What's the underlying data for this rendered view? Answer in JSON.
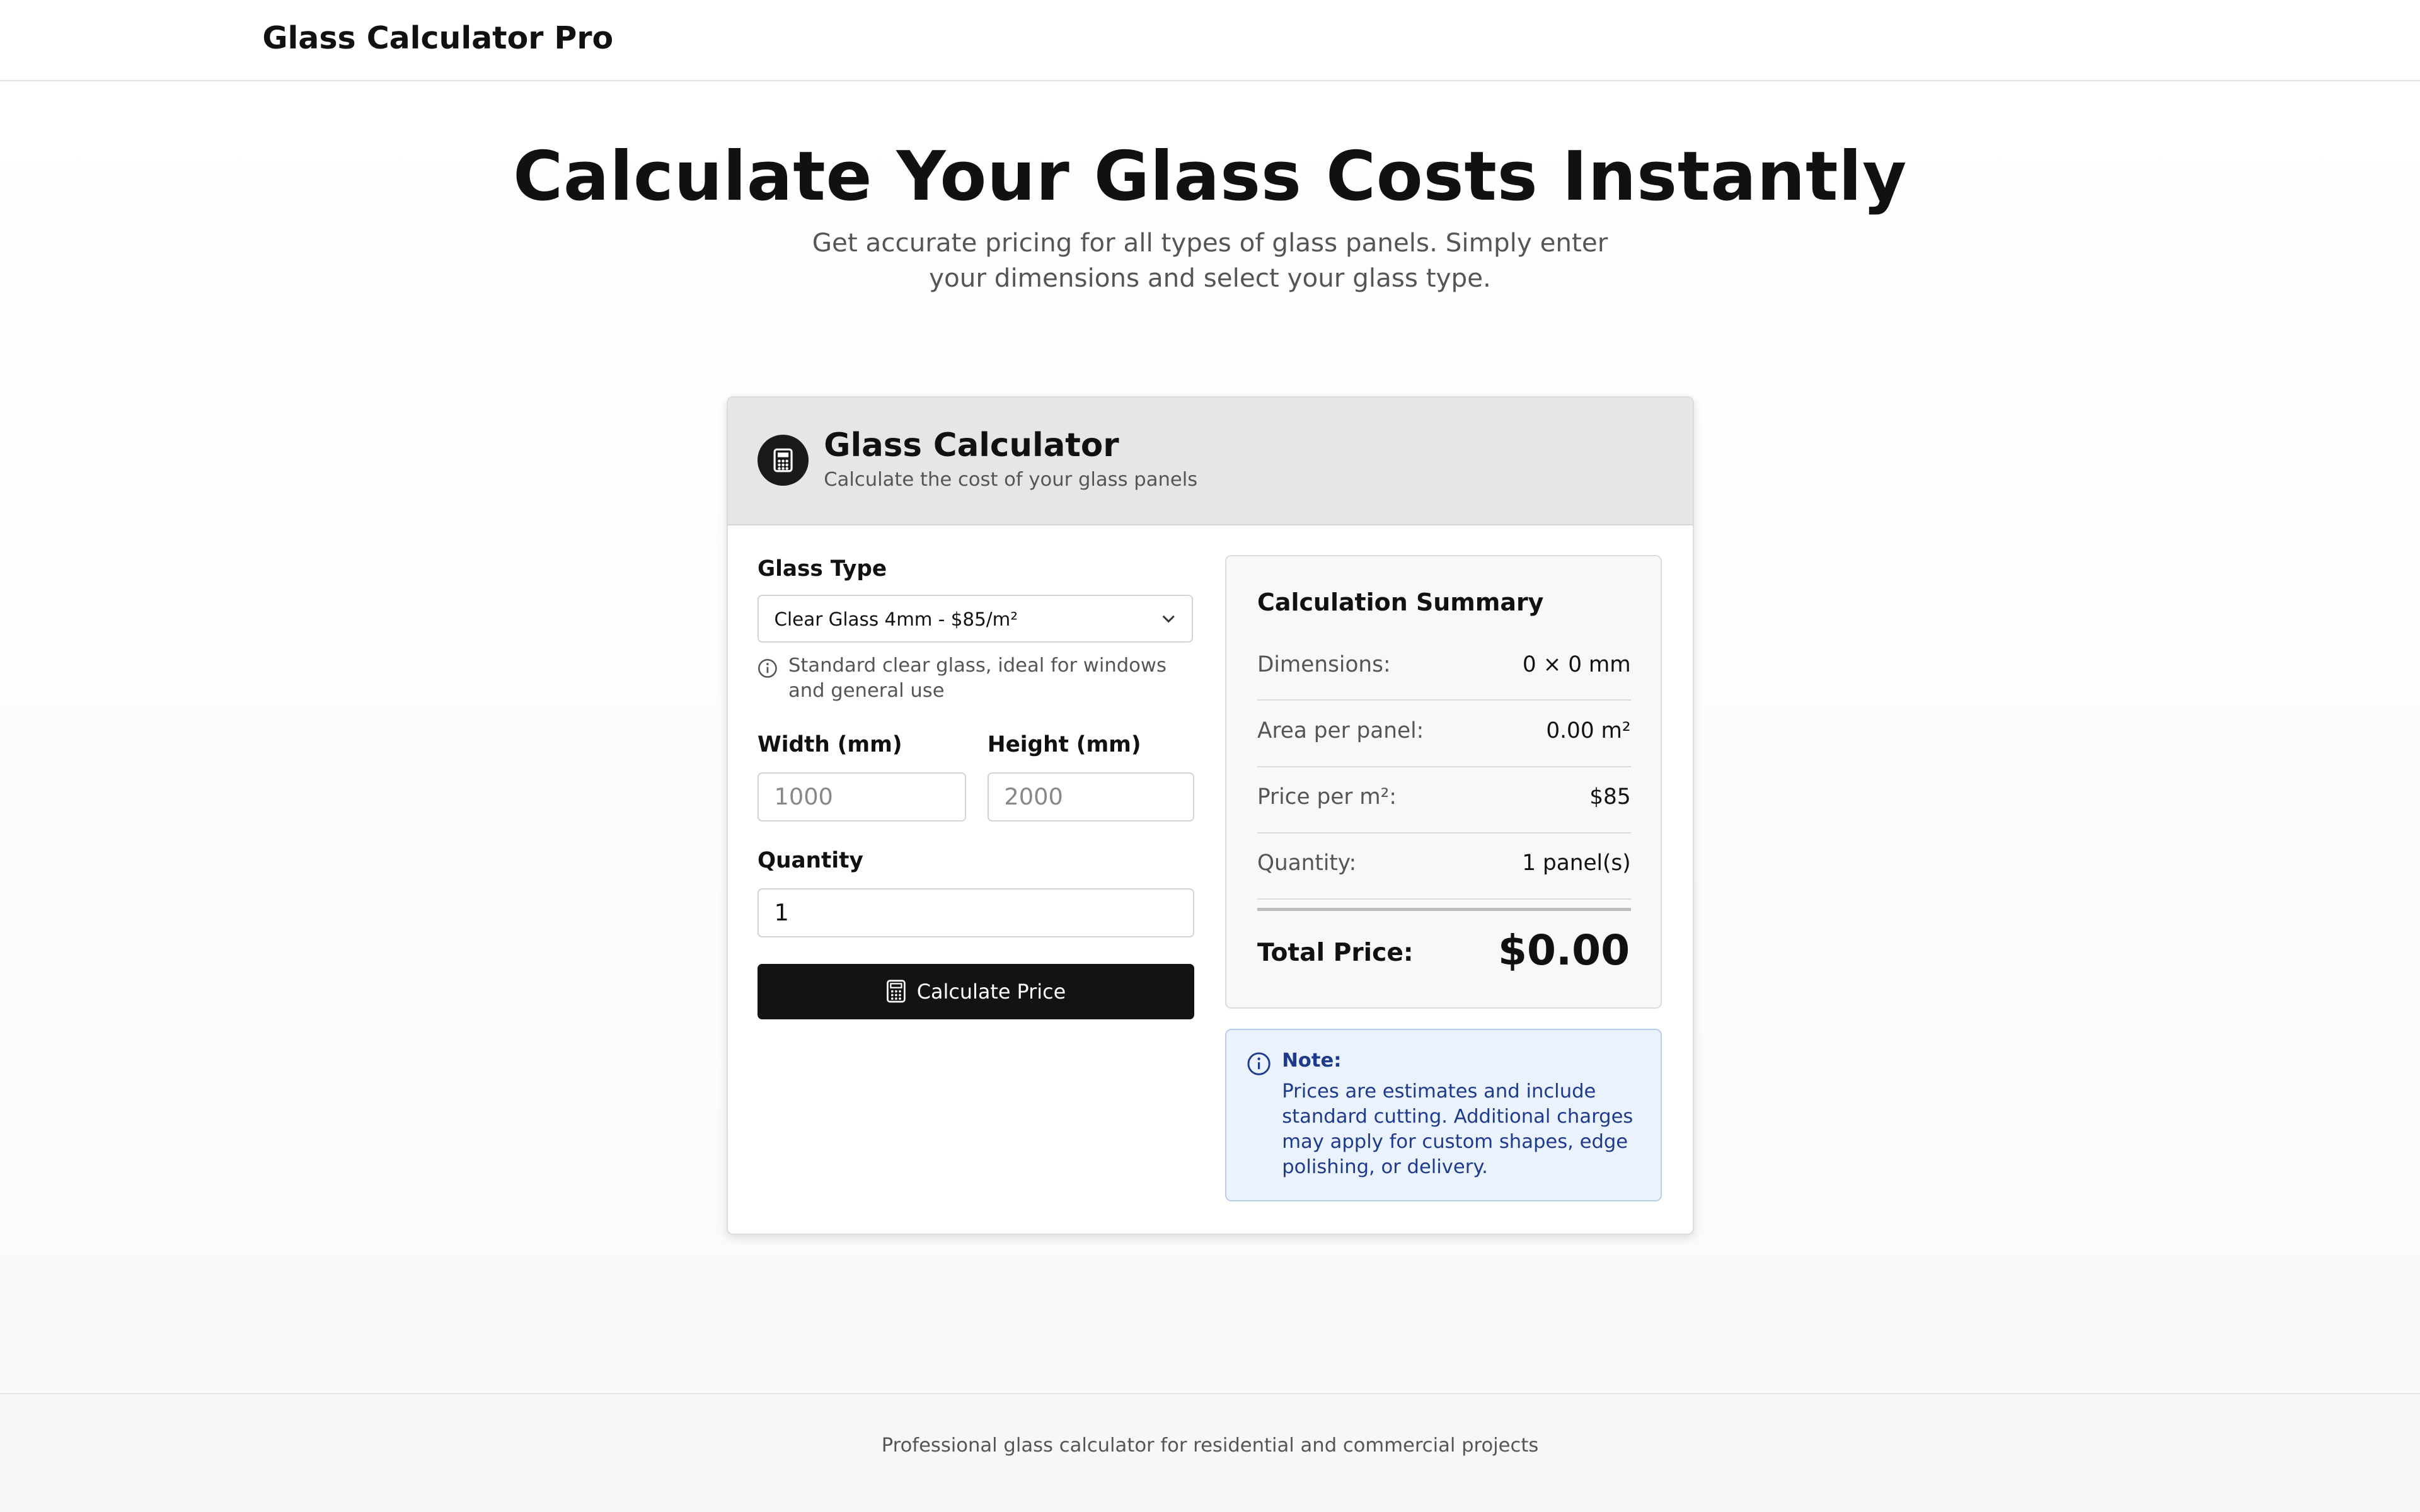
{
  "header": {
    "brand": "Glass Calculator Pro"
  },
  "hero": {
    "title": "Calculate Your Glass Costs Instantly",
    "subtitle": "Get accurate pricing for all types of glass panels. Simply enter your dimensions and select your glass type."
  },
  "calculator": {
    "title": "Glass Calculator",
    "subtitle": "Calculate the cost of your glass panels",
    "icon": "calculator-icon",
    "glass_type": {
      "label": "Glass Type",
      "selected": "Clear Glass 4mm - $85/m²",
      "hint": "Standard clear glass, ideal for windows and general use"
    },
    "width": {
      "label": "Width (mm)",
      "placeholder": "1000",
      "value": ""
    },
    "height": {
      "label": "Height (mm)",
      "placeholder": "2000",
      "value": ""
    },
    "quantity": {
      "label": "Quantity",
      "value": "1"
    },
    "button_label": "Calculate Price"
  },
  "summary": {
    "title": "Calculation Summary",
    "rows": [
      {
        "label": "Dimensions:",
        "value": "0 × 0 mm"
      },
      {
        "label": "Area per panel:",
        "value": "0.00 m²"
      },
      {
        "label": "Price per m²:",
        "value": "$85"
      },
      {
        "label": "Quantity:",
        "value": "1 panel(s)"
      }
    ],
    "total_label": "Total Price:",
    "total_value": "$0.00"
  },
  "note": {
    "title": "Note:",
    "text": "Prices are estimates and include standard cutting. Additional charges may apply for custom shapes, edge polishing, or delivery."
  },
  "footer": {
    "text": "Professional glass calculator for residential and commercial projects"
  },
  "colors": {
    "accent": "#131313",
    "note_bg": "#eaf2fd",
    "note_text": "#1e3a8a"
  }
}
